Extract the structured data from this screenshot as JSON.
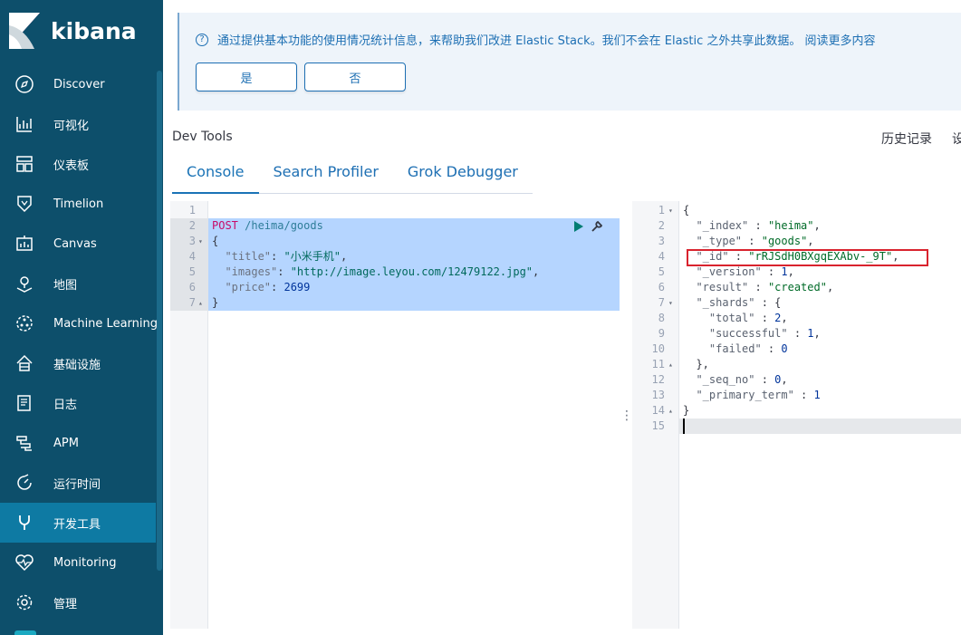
{
  "app": {
    "name": "kibana"
  },
  "sidebar": {
    "items": [
      {
        "label": "Discover",
        "icon": "compass-icon"
      },
      {
        "label": "可视化",
        "icon": "visualize-icon"
      },
      {
        "label": "仪表板",
        "icon": "dashboard-icon"
      },
      {
        "label": "Timelion",
        "icon": "timelion-icon"
      },
      {
        "label": "Canvas",
        "icon": "canvas-icon"
      },
      {
        "label": "地图",
        "icon": "maps-icon"
      },
      {
        "label": "Machine Learning",
        "icon": "machine-learning-icon"
      },
      {
        "label": "基础设施",
        "icon": "infrastructure-icon"
      },
      {
        "label": "日志",
        "icon": "logs-icon"
      },
      {
        "label": "APM",
        "icon": "apm-icon"
      },
      {
        "label": "运行时间",
        "icon": "uptime-icon"
      },
      {
        "label": "开发工具",
        "icon": "dev-tools-icon",
        "active": true
      },
      {
        "label": "Monitoring",
        "icon": "monitoring-icon"
      },
      {
        "label": "管理",
        "icon": "gear-icon"
      }
    ]
  },
  "banner": {
    "message": "通过提供基本功能的使用情况统计信息，来帮助我们改进 Elastic Stack。我们不会在 Elastic 之外共享此数据。 阅读更多内容",
    "yes_label": "是",
    "no_label": "否"
  },
  "header": {
    "title": "Dev Tools",
    "history_label": "历史记录",
    "settings_label": "设"
  },
  "tabs": [
    {
      "label": "Console",
      "active": true
    },
    {
      "label": "Search Profiler"
    },
    {
      "label": "Grok Debugger"
    }
  ],
  "request": {
    "lines": [
      {
        "n": "1",
        "text": ""
      },
      {
        "n": "2",
        "method": "POST",
        "url": " /heima/goods"
      },
      {
        "n": "3",
        "text": "{",
        "fold": "▾"
      },
      {
        "n": "4",
        "key": "  \"title\"",
        "sep": ": ",
        "str": "\"小米手机\"",
        "end": ","
      },
      {
        "n": "5",
        "key": "  \"images\"",
        "sep": ": ",
        "str": "\"http://image.leyou.com/12479122.jpg\"",
        "end": ","
      },
      {
        "n": "6",
        "key": "  \"price\"",
        "sep": ": ",
        "num": "2699"
      },
      {
        "n": "7",
        "text": "}",
        "fold": "▴"
      }
    ]
  },
  "response": {
    "lines": [
      {
        "n": "1",
        "text": "{",
        "fold": "▾"
      },
      {
        "n": "2",
        "key": "  \"_index\"",
        "sep": " : ",
        "str": "\"heima\"",
        "end": ","
      },
      {
        "n": "3",
        "key": "  \"_type\"",
        "sep": " : ",
        "str": "\"goods\"",
        "end": ","
      },
      {
        "n": "4",
        "key": "  \"_id\"",
        "sep": " : ",
        "str": "\"rRJSdH0BXgqEXAbv-_9T\"",
        "end": ","
      },
      {
        "n": "5",
        "key": "  \"_version\"",
        "sep": " : ",
        "num": "1",
        "end": ","
      },
      {
        "n": "6",
        "key": "  \"result\"",
        "sep": " : ",
        "str": "\"created\"",
        "end": ","
      },
      {
        "n": "7",
        "key": "  \"_shards\"",
        "sep": " : ",
        "text2": "{",
        "fold": "▾"
      },
      {
        "n": "8",
        "key": "    \"total\"",
        "sep": " : ",
        "num": "2",
        "end": ","
      },
      {
        "n": "9",
        "key": "    \"successful\"",
        "sep": " : ",
        "num": "1",
        "end": ","
      },
      {
        "n": "10",
        "key": "    \"failed\"",
        "sep": " : ",
        "num": "0"
      },
      {
        "n": "11",
        "text": "  },",
        "fold": "▴"
      },
      {
        "n": "12",
        "key": "  \"_seq_no\"",
        "sep": " : ",
        "num": "0",
        "end": ","
      },
      {
        "n": "13",
        "key": "  \"_primary_term\"",
        "sep": " : ",
        "num": "1"
      },
      {
        "n": "14",
        "text": "}",
        "fold": "▴"
      },
      {
        "n": "15",
        "text": ""
      }
    ]
  },
  "colors": {
    "sidebar_bg": "#0d4f6b",
    "sidebar_active": "#0e7aa3",
    "accent": "#1a73b6",
    "highlight_box": "#d9232e",
    "selection": "#b5d5ff"
  }
}
